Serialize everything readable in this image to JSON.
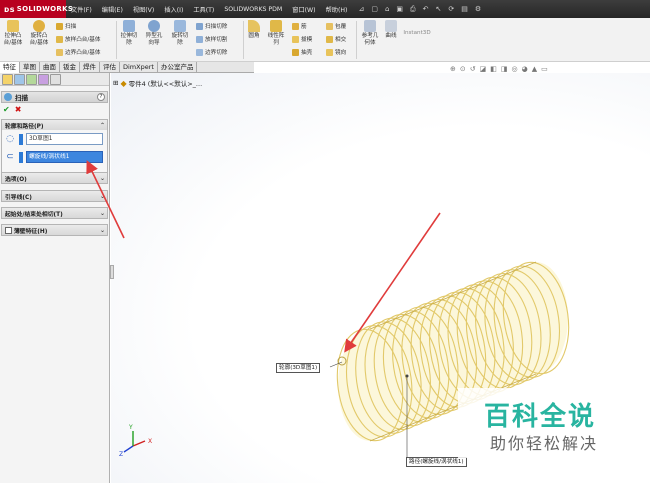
{
  "app": {
    "logo_text": "SOLIDWORKS",
    "menu": [
      "文件(F)",
      "编辑(E)",
      "视图(V)",
      "插入(I)",
      "工具(T)",
      "SOLIDWORKS PDM",
      "窗口(W)",
      "帮助(H)"
    ]
  },
  "ribbon": {
    "boss_extrude": "拉伸凸台/基体",
    "boss_revolve": "旋转凸台/基体",
    "sweep": "扫描",
    "loft_boss": "放样凸台/基体",
    "boundary_boss": "边界凸台/基体",
    "cut_extrude": "拉伸切除",
    "hole_wizard": "异型孔向导",
    "cut_revolve": "旋转切除",
    "swept_cut": "扫描切除",
    "loft_cut": "放样切割",
    "boundary_cut": "边界切除",
    "fillet": "圆角",
    "linear_pattern": "线性阵列",
    "rib": "筋",
    "draft": "拔模",
    "shell": "抽壳",
    "wrap": "包覆",
    "intersect": "相交",
    "mirror": "镜向",
    "ref_geometry": "参考几何体",
    "curves": "曲线",
    "instant3d": "Instant3D"
  },
  "tabs": [
    "特征",
    "草图",
    "曲面",
    "钣金",
    "焊件",
    "评估",
    "DimXpert",
    "办公室产品"
  ],
  "tree": {
    "root": "零件4 (默认<<默认>_..."
  },
  "panel": {
    "title": "扫描",
    "help": "?",
    "profile_group": "轮廓和路径(P)",
    "profile_value": "3D草图1",
    "path_value": "螺旋线/涡状线1",
    "options": "选项(O)",
    "guides": "引导线(C)",
    "tangency": "起始处/结束处相切(T)",
    "thin": "薄壁特征(H)"
  },
  "callouts": {
    "profile": "轮廓(3D草图1)",
    "path": "路径(螺旋线/涡状线1)"
  },
  "triad": {
    "x": "X",
    "y": "Y",
    "z": "Z"
  },
  "watermark": {
    "title": "百科全说",
    "subtitle": "助你轻松解决"
  },
  "colors": {
    "preview_coil": "#e2c96a",
    "preview_fill": "#fbf4cf",
    "arrow": "#e03c3c",
    "selection": "#3d86df",
    "watermark": "#28b4a0"
  }
}
